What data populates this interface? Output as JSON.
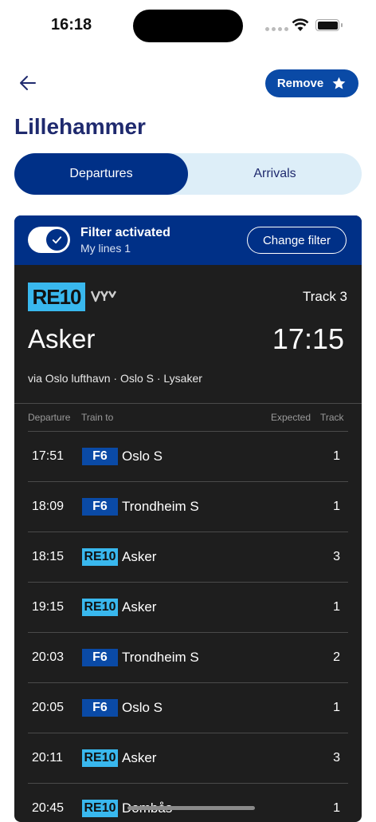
{
  "status": {
    "time": "16:18"
  },
  "header": {
    "remove_label": "Remove",
    "station": "Lillehammer"
  },
  "tabs": [
    {
      "label": "Departures"
    },
    {
      "label": "Arrivals"
    }
  ],
  "filter": {
    "title": "Filter activated",
    "subtitle": "My lines 1",
    "change_label": "Change filter"
  },
  "next": {
    "line": "RE10",
    "track": "Track 3",
    "destination": "Asker",
    "time": "17:15",
    "via": "via Oslo lufthavn  · Oslo S · Lysaker"
  },
  "columns": {
    "departure": "Departure",
    "train_to": "Train to",
    "expected": "Expected",
    "track": "Track"
  },
  "departures": [
    {
      "time": "17:51",
      "line": "F6",
      "line_style": "blue",
      "destination": "Oslo S",
      "track": "1"
    },
    {
      "time": "18:09",
      "line": "F6",
      "line_style": "blue",
      "destination": "Trondheim S",
      "track": "1"
    },
    {
      "time": "18:15",
      "line": "RE10",
      "line_style": "cyan",
      "destination": "Asker",
      "track": "3"
    },
    {
      "time": "19:15",
      "line": "RE10",
      "line_style": "cyan",
      "destination": "Asker",
      "track": "1"
    },
    {
      "time": "20:03",
      "line": "F6",
      "line_style": "blue",
      "destination": "Trondheim S",
      "track": "2"
    },
    {
      "time": "20:05",
      "line": "F6",
      "line_style": "blue",
      "destination": "Oslo S",
      "track": "1"
    },
    {
      "time": "20:11",
      "line": "RE10",
      "line_style": "cyan",
      "destination": "Asker",
      "track": "3"
    },
    {
      "time": "20:45",
      "line": "RE10",
      "line_style": "cyan",
      "destination": "Dombås",
      "track": "1"
    }
  ],
  "colors": {
    "brand_blue": "#003087",
    "line_blue": "#0a4aa6",
    "line_cyan": "#39b8ee",
    "card_bg": "#1e1e1e"
  }
}
